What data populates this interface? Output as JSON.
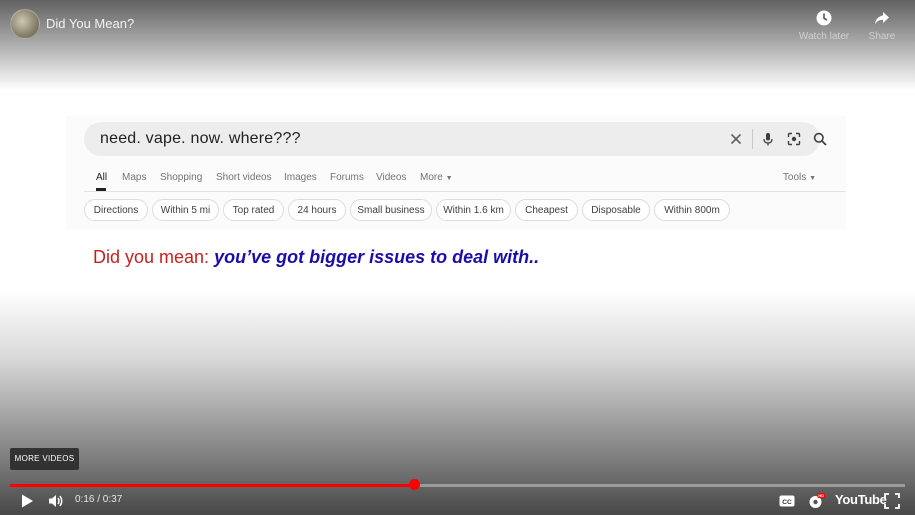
{
  "player": {
    "title": "Did You Mean?",
    "top_actions": [
      {
        "label": "Watch later",
        "icon": "clock-icon"
      },
      {
        "label": "Share",
        "icon": "share-icon"
      }
    ],
    "more_videos_label": "MORE VIDEOS",
    "time_display": "0:16 / 0:37",
    "progress_fraction": 0.451,
    "brand_label": "YouTube",
    "accent_color": "#ff0000",
    "controls": [
      "play-icon",
      "volume-icon",
      "captions-icon",
      "settings-icon",
      "fullscreen-icon"
    ]
  },
  "search": {
    "query": "need. vape. now. where???",
    "icons": [
      "clear-icon",
      "microphone-icon",
      "lens-icon",
      "search-icon"
    ],
    "tabs": [
      "All",
      "Maps",
      "Shopping",
      "Short videos",
      "Images",
      "Forums",
      "Videos",
      "More"
    ],
    "active_tab": "All",
    "tools_label": "Tools",
    "chips": [
      "Directions",
      "Within 5 mi",
      "Top rated",
      "24 hours",
      "Small business",
      "Within 1.6 km",
      "Cheapest",
      "Disposable",
      "Within 800m"
    ],
    "did_you_mean_prefix": "Did you mean:",
    "did_you_mean_suggestion": "you’ve got bigger issues to deal with..",
    "prefix_color": "#c5221f",
    "suggestion_color": "#1a0dab"
  }
}
